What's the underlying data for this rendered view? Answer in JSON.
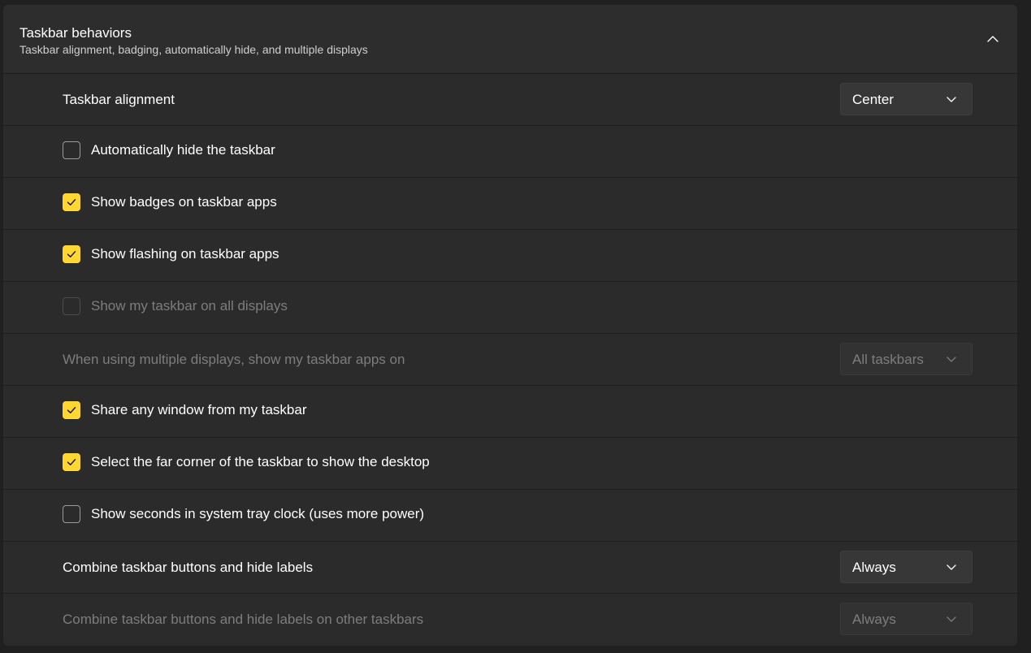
{
  "section": {
    "title": "Taskbar behaviors",
    "subtitle": "Taskbar alignment, badging, automatically hide, and multiple displays",
    "collapse_icon": "chevron-up-icon"
  },
  "rows": {
    "alignment": {
      "label": "Taskbar alignment",
      "value": "Center"
    },
    "auto_hide": {
      "label": "Automatically hide the taskbar",
      "checked": false
    },
    "badges": {
      "label": "Show badges on taskbar apps",
      "checked": true
    },
    "flashing": {
      "label": "Show flashing on taskbar apps",
      "checked": true
    },
    "all_displays": {
      "label": "Show my taskbar on all displays",
      "checked": false,
      "disabled": true
    },
    "multi_display_apps": {
      "label": "When using multiple displays, show my taskbar apps on",
      "value": "All taskbars",
      "disabled": true
    },
    "share_window": {
      "label": "Share any window from my taskbar",
      "checked": true
    },
    "far_corner": {
      "label": "Select the far corner of the taskbar to show the desktop",
      "checked": true
    },
    "seconds": {
      "label": "Show seconds in system tray clock (uses more power)",
      "checked": false
    },
    "combine": {
      "label": "Combine taskbar buttons and hide labels",
      "value": "Always"
    },
    "combine_other": {
      "label": "Combine taskbar buttons and hide labels on other taskbars",
      "value": "Always",
      "disabled": true
    }
  },
  "colors": {
    "accent": "#ffd733",
    "background": "#202020",
    "card": "#2b2b2b",
    "disabled_text": "#7d7d7d"
  }
}
